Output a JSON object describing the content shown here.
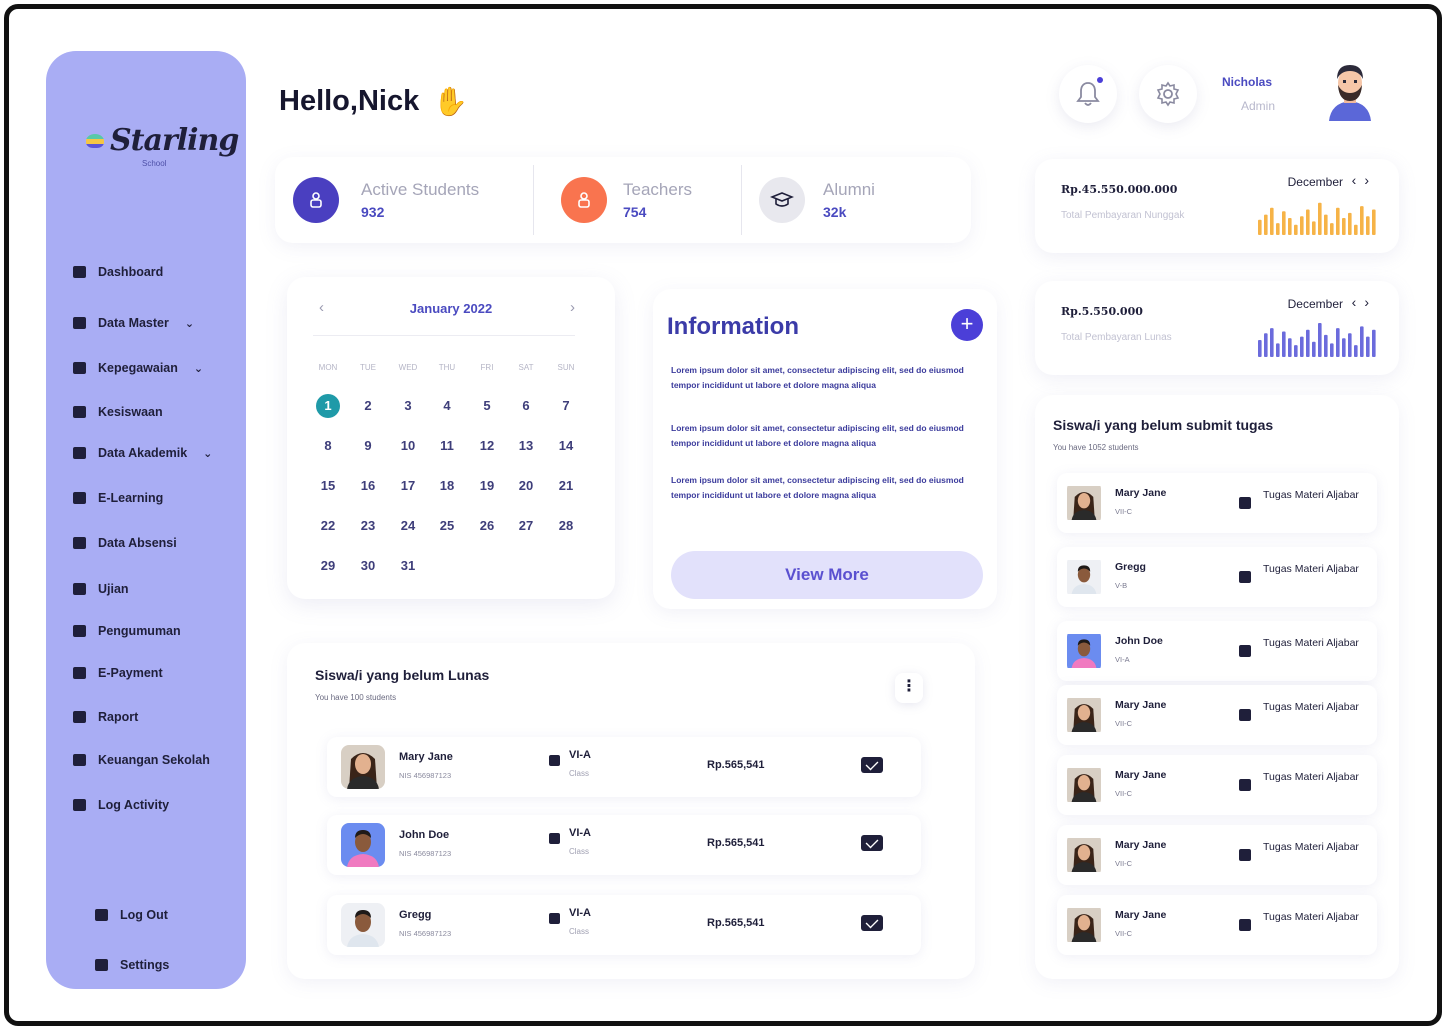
{
  "brand": {
    "name": "Starling",
    "sub": "School"
  },
  "greeting": "Hello,Nick",
  "sidebar": {
    "items": [
      {
        "label": "Dashboard",
        "icon": "dashboard-icon",
        "dropdown": false
      },
      {
        "label": "Data Master",
        "icon": "data-master-icon",
        "dropdown": true
      },
      {
        "label": "Kepegawaian",
        "icon": "kepegawaian-icon",
        "dropdown": true
      },
      {
        "label": "Kesiswaan",
        "icon": "kesiswaan-icon",
        "dropdown": false
      },
      {
        "label": "Data Akademik",
        "icon": "akademik-icon",
        "dropdown": true
      },
      {
        "label": "E-Learning",
        "icon": "e-learning-icon",
        "dropdown": false
      },
      {
        "label": "Data Absensi",
        "icon": "absensi-icon",
        "dropdown": false
      },
      {
        "label": "Ujian",
        "icon": "ujian-icon",
        "dropdown": false
      },
      {
        "label": "Pengumuman",
        "icon": "pengumuman-icon",
        "dropdown": false
      },
      {
        "label": "E-Payment",
        "icon": "e-payment-icon",
        "dropdown": false
      },
      {
        "label": "Raport",
        "icon": "raport-icon",
        "dropdown": false
      },
      {
        "label": "Keuangan Sekolah",
        "icon": "keuangan-icon",
        "dropdown": false
      },
      {
        "label": "Log Activity",
        "icon": "log-activity-icon",
        "dropdown": false
      }
    ],
    "bottom": [
      {
        "label": "Log Out",
        "icon": "logout-icon"
      },
      {
        "label": "Settings",
        "icon": "gear-icon"
      }
    ]
  },
  "header": {
    "user_name": "Nicholas",
    "user_role": "Admin"
  },
  "stats": [
    {
      "label": "Active Students",
      "value": "932",
      "color": "#4a3fc0"
    },
    {
      "label": "Teachers",
      "value": "754",
      "color": "#f9744f"
    },
    {
      "label": "Alumni",
      "value": "32k",
      "color": "#e8e8ee"
    }
  ],
  "calendar": {
    "month": "January 2022",
    "dow": [
      "MON",
      "TUE",
      "WED",
      "THU",
      "FRI",
      "SAT",
      "SUN"
    ],
    "days": [
      "1",
      "2",
      "3",
      "4",
      "5",
      "6",
      "7",
      "8",
      "9",
      "10",
      "11",
      "12",
      "13",
      "14",
      "15",
      "16",
      "17",
      "18",
      "19",
      "20",
      "21",
      "22",
      "23",
      "24",
      "25",
      "26",
      "27",
      "28",
      "29",
      "30",
      "31"
    ],
    "today": "1"
  },
  "information": {
    "title": "Information",
    "paragraphs": [
      "Lorem ipsum dolor sit amet, consectetur adipiscing elit, sed do eiusmod tempor incididunt ut labore et dolore magna aliqua",
      "Lorem ipsum dolor sit amet, consectetur adipiscing elit, sed do eiusmod tempor incididunt ut labore et dolore magna aliqua",
      "Lorem ipsum dolor sit amet, consectetur adipiscing elit, sed do eiusmod tempor incididunt ut labore et dolore magna aliqua"
    ],
    "button": "View More"
  },
  "payments": [
    {
      "amount": "Rp.45.550.000.000",
      "label": "Total Pembayaran Nunggak",
      "month": "December",
      "color": "#f6b347",
      "bars": [
        0.45,
        0.6,
        0.8,
        0.35,
        0.7,
        0.5,
        0.3,
        0.55,
        0.75,
        0.4,
        0.95,
        0.6,
        0.35,
        0.8,
        0.5,
        0.65,
        0.3,
        0.85,
        0.55,
        0.75
      ]
    },
    {
      "amount": "Rp.5.550.000",
      "label": "Total Pembayaran Lunas",
      "month": "December",
      "color": "#6b6bdc",
      "bars": [
        0.5,
        0.7,
        0.85,
        0.4,
        0.75,
        0.55,
        0.35,
        0.6,
        0.8,
        0.45,
        1.0,
        0.65,
        0.4,
        0.85,
        0.55,
        0.7,
        0.35,
        0.9,
        0.6,
        0.8
      ]
    }
  ],
  "lunas": {
    "title": "Siswa/i yang belum Lunas",
    "subtitle": "You have 100 students",
    "class_label": "Class",
    "rows": [
      {
        "name": "Mary Jane",
        "nis": "NIS 456987123",
        "class": "VI-A",
        "amount": "Rp.565,541"
      },
      {
        "name": "John Doe",
        "nis": "NIS 456987123",
        "class": "VI-A",
        "amount": "Rp.565,541"
      },
      {
        "name": "Gregg",
        "nis": "NIS 456987123",
        "class": "VI-A",
        "amount": "Rp.565,541"
      }
    ]
  },
  "tugas": {
    "title": "Siswa/i yang belum submit tugas",
    "subtitle": "You have 1052 students",
    "rows": [
      {
        "name": "Mary Jane",
        "class": "VII-C",
        "task": "Tugas Materi Aljabar"
      },
      {
        "name": "Gregg",
        "class": "V-B",
        "task": "Tugas Materi Aljabar"
      },
      {
        "name": "John Doe",
        "class": "VI-A",
        "task": "Tugas Materi Aljabar"
      },
      {
        "name": "Mary Jane",
        "class": "VII-C",
        "task": "Tugas Materi Aljabar"
      },
      {
        "name": "Mary Jane",
        "class": "VII-C",
        "task": "Tugas Materi Aljabar"
      },
      {
        "name": "Mary Jane",
        "class": "VII-C",
        "task": "Tugas Materi Aljabar"
      },
      {
        "name": "Mary Jane",
        "class": "VII-C",
        "task": "Tugas Materi Aljabar"
      }
    ]
  }
}
